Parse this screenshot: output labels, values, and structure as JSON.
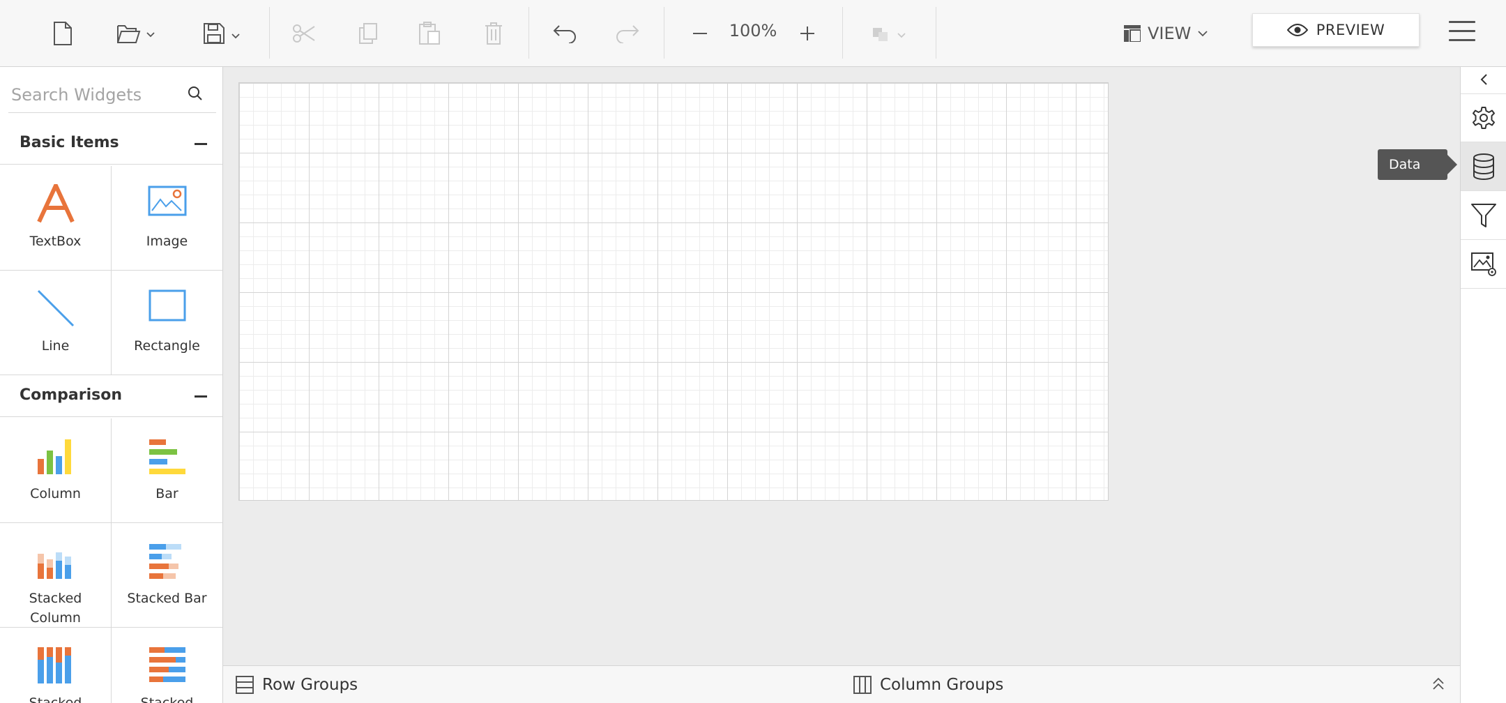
{
  "toolbar": {
    "zoom_level": "100%",
    "view_label": "VIEW",
    "preview_label": "PREVIEW"
  },
  "sidebar": {
    "search_placeholder": "Search Widgets",
    "groups": [
      {
        "title": "Basic Items",
        "items": [
          {
            "label": "TextBox",
            "icon": "textbox-icon"
          },
          {
            "label": "Image",
            "icon": "image-icon"
          },
          {
            "label": "Line",
            "icon": "line-icon"
          },
          {
            "label": "Rectangle",
            "icon": "rectangle-icon"
          }
        ]
      },
      {
        "title": "Comparison",
        "items": [
          {
            "label": "Column",
            "icon": "column-chart-icon"
          },
          {
            "label": "Bar",
            "icon": "bar-chart-icon"
          },
          {
            "label": "Stacked Column",
            "icon": "stacked-column-icon"
          },
          {
            "label": "Stacked Bar",
            "icon": "stacked-bar-icon"
          },
          {
            "label": "Stacked",
            "icon": "stacked-column-100-icon"
          },
          {
            "label": "Stacked",
            "icon": "stacked-bar-100-icon"
          }
        ]
      }
    ]
  },
  "groups_bar": {
    "row_groups_label": "Row Groups",
    "column_groups_label": "Column Groups"
  },
  "right_panel": {
    "tooltip": "Data",
    "buttons": [
      "properties",
      "data",
      "filter",
      "image-manager"
    ]
  },
  "colors": {
    "orange": "#E8743B",
    "blue": "#4A9FEA",
    "green": "#7CC242",
    "yellow": "#FFD93B"
  }
}
